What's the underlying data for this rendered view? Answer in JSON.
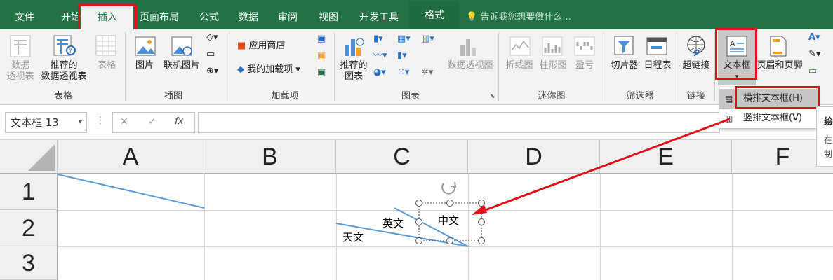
{
  "tabs": [
    {
      "label": "文件"
    },
    {
      "label": "开始"
    },
    {
      "label": "插入"
    },
    {
      "label": "页面布局"
    },
    {
      "label": "公式"
    },
    {
      "label": "数据"
    },
    {
      "label": "审阅"
    },
    {
      "label": "视图"
    },
    {
      "label": "开发工具"
    },
    {
      "label": "格式"
    }
  ],
  "tell_me": "告诉我您想要做什么...",
  "ribbon": {
    "pivot_l1": "数据",
    "pivot_l2": "透视表",
    "rec_pivot_l1": "推荐的",
    "rec_pivot_l2": "数据透视表",
    "table": "表格",
    "picture": "图片",
    "online_picture": "联机图片",
    "app_store": "应用商店",
    "my_addins": "我的加载项",
    "rec_charts_l1": "推荐的",
    "rec_charts_l2": "图表",
    "pivot_chart": "数据透视图",
    "line_spark": "折线图",
    "column_spark": "柱形图",
    "winloss_spark": "盈亏",
    "slicer": "切片器",
    "timeline": "日程表",
    "hyperlink": "超链接",
    "textbox": "文本框",
    "header_footer": "页眉和页脚",
    "groups": {
      "tables": "表格",
      "illustrations": "插图",
      "addins": "加载项",
      "charts": "图表",
      "sparklines": "迷你图",
      "filters": "筛选器",
      "links": "链接"
    }
  },
  "name_box": "文本框 13",
  "formula_icons": {
    "cancel": "✕",
    "enter": "✓",
    "fx": "fx"
  },
  "columns": [
    "A",
    "B",
    "C",
    "D",
    "E",
    "F"
  ],
  "rows": [
    "1",
    "2",
    "3"
  ],
  "dropdown": {
    "horizontal": "横排文本框(H)",
    "vertical": "竖排文本框(V)"
  },
  "tooltip": {
    "l1": "绘",
    "l2": "在",
    "l3": "制"
  },
  "cells": {
    "english": "英文",
    "astronomy": "天文",
    "chinese": "中文"
  },
  "colors": {
    "brand": "#217346",
    "highlight": "#e0101a",
    "line": "#5b9bd5"
  }
}
